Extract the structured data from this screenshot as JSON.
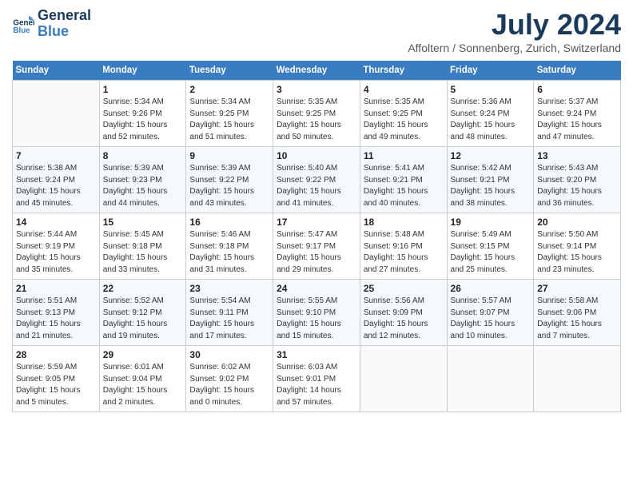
{
  "header": {
    "logo_line1": "General",
    "logo_line2": "Blue",
    "title": "July 2024",
    "subtitle": "Affoltern / Sonnenberg, Zurich, Switzerland"
  },
  "calendar": {
    "days_of_week": [
      "Sunday",
      "Monday",
      "Tuesday",
      "Wednesday",
      "Thursday",
      "Friday",
      "Saturday"
    ],
    "weeks": [
      [
        {
          "day": "",
          "info": ""
        },
        {
          "day": "1",
          "info": "Sunrise: 5:34 AM\nSunset: 9:26 PM\nDaylight: 15 hours\nand 52 minutes."
        },
        {
          "day": "2",
          "info": "Sunrise: 5:34 AM\nSunset: 9:25 PM\nDaylight: 15 hours\nand 51 minutes."
        },
        {
          "day": "3",
          "info": "Sunrise: 5:35 AM\nSunset: 9:25 PM\nDaylight: 15 hours\nand 50 minutes."
        },
        {
          "day": "4",
          "info": "Sunrise: 5:35 AM\nSunset: 9:25 PM\nDaylight: 15 hours\nand 49 minutes."
        },
        {
          "day": "5",
          "info": "Sunrise: 5:36 AM\nSunset: 9:24 PM\nDaylight: 15 hours\nand 48 minutes."
        },
        {
          "day": "6",
          "info": "Sunrise: 5:37 AM\nSunset: 9:24 PM\nDaylight: 15 hours\nand 47 minutes."
        }
      ],
      [
        {
          "day": "7",
          "info": "Sunrise: 5:38 AM\nSunset: 9:24 PM\nDaylight: 15 hours\nand 45 minutes."
        },
        {
          "day": "8",
          "info": "Sunrise: 5:39 AM\nSunset: 9:23 PM\nDaylight: 15 hours\nand 44 minutes."
        },
        {
          "day": "9",
          "info": "Sunrise: 5:39 AM\nSunset: 9:22 PM\nDaylight: 15 hours\nand 43 minutes."
        },
        {
          "day": "10",
          "info": "Sunrise: 5:40 AM\nSunset: 9:22 PM\nDaylight: 15 hours\nand 41 minutes."
        },
        {
          "day": "11",
          "info": "Sunrise: 5:41 AM\nSunset: 9:21 PM\nDaylight: 15 hours\nand 40 minutes."
        },
        {
          "day": "12",
          "info": "Sunrise: 5:42 AM\nSunset: 9:21 PM\nDaylight: 15 hours\nand 38 minutes."
        },
        {
          "day": "13",
          "info": "Sunrise: 5:43 AM\nSunset: 9:20 PM\nDaylight: 15 hours\nand 36 minutes."
        }
      ],
      [
        {
          "day": "14",
          "info": "Sunrise: 5:44 AM\nSunset: 9:19 PM\nDaylight: 15 hours\nand 35 minutes."
        },
        {
          "day": "15",
          "info": "Sunrise: 5:45 AM\nSunset: 9:18 PM\nDaylight: 15 hours\nand 33 minutes."
        },
        {
          "day": "16",
          "info": "Sunrise: 5:46 AM\nSunset: 9:18 PM\nDaylight: 15 hours\nand 31 minutes."
        },
        {
          "day": "17",
          "info": "Sunrise: 5:47 AM\nSunset: 9:17 PM\nDaylight: 15 hours\nand 29 minutes."
        },
        {
          "day": "18",
          "info": "Sunrise: 5:48 AM\nSunset: 9:16 PM\nDaylight: 15 hours\nand 27 minutes."
        },
        {
          "day": "19",
          "info": "Sunrise: 5:49 AM\nSunset: 9:15 PM\nDaylight: 15 hours\nand 25 minutes."
        },
        {
          "day": "20",
          "info": "Sunrise: 5:50 AM\nSunset: 9:14 PM\nDaylight: 15 hours\nand 23 minutes."
        }
      ],
      [
        {
          "day": "21",
          "info": "Sunrise: 5:51 AM\nSunset: 9:13 PM\nDaylight: 15 hours\nand 21 minutes."
        },
        {
          "day": "22",
          "info": "Sunrise: 5:52 AM\nSunset: 9:12 PM\nDaylight: 15 hours\nand 19 minutes."
        },
        {
          "day": "23",
          "info": "Sunrise: 5:54 AM\nSunset: 9:11 PM\nDaylight: 15 hours\nand 17 minutes."
        },
        {
          "day": "24",
          "info": "Sunrise: 5:55 AM\nSunset: 9:10 PM\nDaylight: 15 hours\nand 15 minutes."
        },
        {
          "day": "25",
          "info": "Sunrise: 5:56 AM\nSunset: 9:09 PM\nDaylight: 15 hours\nand 12 minutes."
        },
        {
          "day": "26",
          "info": "Sunrise: 5:57 AM\nSunset: 9:07 PM\nDaylight: 15 hours\nand 10 minutes."
        },
        {
          "day": "27",
          "info": "Sunrise: 5:58 AM\nSunset: 9:06 PM\nDaylight: 15 hours\nand 7 minutes."
        }
      ],
      [
        {
          "day": "28",
          "info": "Sunrise: 5:59 AM\nSunset: 9:05 PM\nDaylight: 15 hours\nand 5 minutes."
        },
        {
          "day": "29",
          "info": "Sunrise: 6:01 AM\nSunset: 9:04 PM\nDaylight: 15 hours\nand 2 minutes."
        },
        {
          "day": "30",
          "info": "Sunrise: 6:02 AM\nSunset: 9:02 PM\nDaylight: 15 hours\nand 0 minutes."
        },
        {
          "day": "31",
          "info": "Sunrise: 6:03 AM\nSunset: 9:01 PM\nDaylight: 14 hours\nand 57 minutes."
        },
        {
          "day": "",
          "info": ""
        },
        {
          "day": "",
          "info": ""
        },
        {
          "day": "",
          "info": ""
        }
      ]
    ]
  }
}
